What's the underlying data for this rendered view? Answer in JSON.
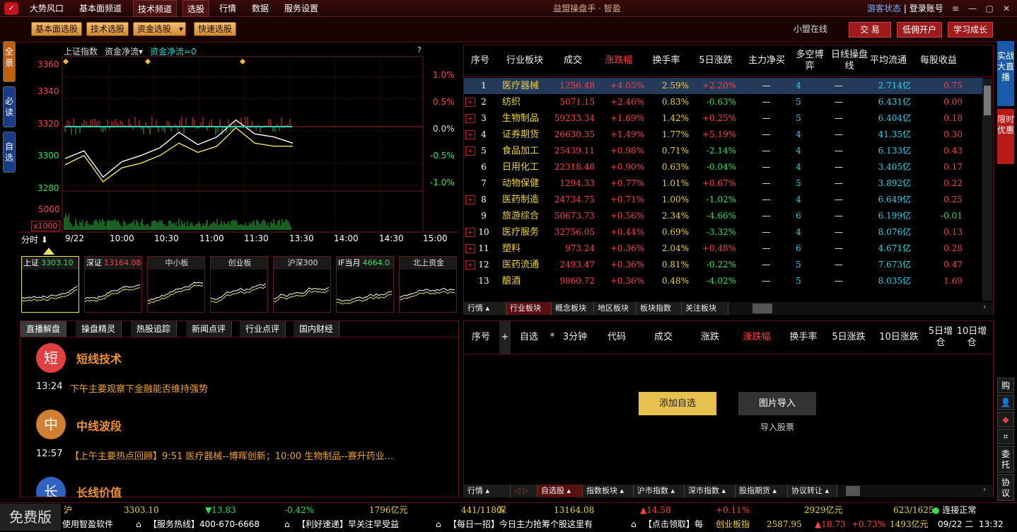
{
  "title_bar": {
    "menus": [
      "大势风口",
      "基本面频道",
      "技术频道",
      "选股",
      "行情",
      "数据",
      "服务设置"
    ],
    "app_title": "益盟操盘手 · 智盈",
    "guest": "游客状态",
    "sep": " | ",
    "login": "登录账号"
  },
  "toolbar": {
    "buttons": [
      "基本面选股",
      "技术选股",
      "资金选股",
      "快速选股"
    ],
    "online": "小盟在线",
    "trade": "交 易",
    "low_fee": "低佣开户",
    "learn": "学习成长"
  },
  "left_tabs": [
    "全景",
    "必读",
    "自选"
  ],
  "chart": {
    "index_name": "上证指数",
    "indicator": "资金净流▾",
    "indicator_value": "资金净流=0",
    "help": "?",
    "period": "分时",
    "left_ticks": [
      "3360",
      "3340",
      "3320",
      "3300",
      "3280"
    ],
    "right_ticks": [
      "1.0%",
      "0.5%",
      "0.0%",
      "-0.5%",
      "-1.0%"
    ],
    "vol_tick": "5000",
    "vol_unit": "x1000",
    "time_ticks": [
      "9/22",
      "10:00",
      "10:30",
      "11:00",
      "11:30",
      "13:30",
      "14:00",
      "14:30",
      "15:00"
    ]
  },
  "chart_data": {
    "type": "line",
    "series": [
      {
        "values": [
          3296,
          3301,
          3284,
          3294,
          3298,
          3303,
          3313,
          3305,
          3310,
          3321,
          3312,
          3310,
          3306
        ]
      },
      {
        "values": [
          3292,
          3298,
          3281,
          3290,
          3293,
          3298,
          3306,
          3300,
          3304,
          3316,
          3306,
          3304,
          3304
        ]
      }
    ],
    "ylim": [
      3275,
      3362
    ]
  },
  "thumbs": [
    {
      "name": "上证",
      "value": "3303.10",
      "color": "#30e050"
    },
    {
      "name": "深证",
      "value": "13164.08",
      "color": "#ff4040"
    },
    {
      "name": "中小板",
      "value": "",
      "color": "#fff"
    },
    {
      "name": "创业板",
      "value": "",
      "color": "#fff"
    },
    {
      "name": "沪深300",
      "value": "",
      "color": "#fff"
    },
    {
      "name": "IF当月",
      "value": "4664.0",
      "color": "#30e050"
    },
    {
      "name": "北上资金",
      "value": "",
      "color": "#fff"
    }
  ],
  "news": {
    "tabs": [
      "直播解盘",
      "操盘精灵",
      "热股追踪",
      "新闻点评",
      "行业点评",
      "国内财经"
    ],
    "items": [
      {
        "badge": "短",
        "title": "短线技术",
        "time": "13:24",
        "text": "下午主要观察下金融能否维持强势",
        "color": "#e04040"
      },
      {
        "badge": "中",
        "title": "中线波段",
        "time": "12:57",
        "text": "【上午主要热点回顾】9:51 医疗器械--博晖创新；10:00 生物制品--赛升药业...",
        "color": "#d08030"
      },
      {
        "badge": "长",
        "title": "长线价值",
        "time": "",
        "text": "",
        "color": "#3060c0"
      }
    ]
  },
  "table1": {
    "headers": [
      "序号",
      "行业板块",
      "成交",
      "涨跌幅",
      "换手率",
      "5日涨跌",
      "主力净买",
      "多空博弈",
      "日线操盘线",
      "平均流通",
      "每股收益"
    ],
    "rows": [
      [
        "1",
        "医疗器械",
        "1256.48",
        "+4.05%",
        "2.59%",
        "+2.20%",
        "—",
        "4",
        "—",
        "2.714亿",
        "0.75"
      ],
      [
        "2",
        "纺织",
        "5071.15",
        "+2.46%",
        "0.83%",
        "-0.63%",
        "—",
        "5",
        "—",
        "6.431亿",
        "0.09"
      ],
      [
        "3",
        "生物制品",
        "59233.34",
        "+1.69%",
        "1.42%",
        "+0.25%",
        "—",
        "5",
        "—",
        "6.404亿",
        "0.18"
      ],
      [
        "4",
        "证券期货",
        "26630.35",
        "+1.49%",
        "1.77%",
        "+5.19%",
        "—",
        "4",
        "—",
        "41.35亿",
        "0.30"
      ],
      [
        "5",
        "食品加工",
        "25439.11",
        "+0.98%",
        "0.71%",
        "-2.14%",
        "—",
        "4",
        "—",
        "6.133亿",
        "0.43"
      ],
      [
        "6",
        "日用化工",
        "22318.48",
        "+0.90%",
        "0.63%",
        "-0.04%",
        "—",
        "4",
        "—",
        "3.405亿",
        "0.17"
      ],
      [
        "7",
        "动物保健",
        "1294.33",
        "+0.77%",
        "1.01%",
        "+0.67%",
        "—",
        "5",
        "—",
        "3.892亿",
        "0.22"
      ],
      [
        "8",
        "医药制造",
        "24734.75",
        "+0.71%",
        "1.00%",
        "-1.02%",
        "—",
        "4",
        "—",
        "6.649亿",
        "0.25"
      ],
      [
        "9",
        "旅游综合",
        "50673.73",
        "+0.56%",
        "2.34%",
        "-4.66%",
        "—",
        "6",
        "—",
        "6.199亿",
        "-0.01"
      ],
      [
        "10",
        "医疗服务",
        "32756.05",
        "+0.44%",
        "0.69%",
        "-3.32%",
        "—",
        "4",
        "—",
        "8.076亿",
        "0.13"
      ],
      [
        "11",
        "塑料",
        "973.24",
        "+0.36%",
        "2.04%",
        "+0.48%",
        "—",
        "6",
        "—",
        "4.671亿",
        "0.28"
      ],
      [
        "12",
        "医药流通",
        "2493.47",
        "+0.36%",
        "0.81%",
        "-0.22%",
        "—",
        "5",
        "—",
        "7.673亿",
        "0.47"
      ],
      [
        "13",
        "酿酒",
        "9860.72",
        "+0.36%",
        "0.48%",
        "-4.02%",
        "—",
        "5",
        "—",
        "8.035亿",
        "1.69"
      ]
    ],
    "tabs": [
      "行情 ▴",
      "行业板块",
      "概念板块",
      "地区板块",
      "板块指数",
      "关注板块"
    ]
  },
  "table2": {
    "headers": [
      "序号",
      "+",
      "自选",
      "*",
      "3分钟",
      "代码",
      "成交",
      "涨跌",
      "涨跌幅",
      "换手率",
      "5日涨跌",
      "10日涨跌",
      "5日增仓",
      "10日增仓"
    ],
    "add_btn": "添加自选",
    "import_btn": "图片导入",
    "import_text": "导入股票",
    "tabs": [
      "行情 ▴",
      "◁ ▷",
      "自选股 ▴",
      "指数板块 ▴",
      "沪市指数 ▴",
      "深市指数 ▴",
      "股指期货 ▴",
      "协议转让 ▴"
    ]
  },
  "right_side": {
    "live": "实战大直播",
    "promo": "限时优惠",
    "icons": [
      "购",
      "委托",
      "协议"
    ]
  },
  "status": {
    "free": "免费版",
    "sh": "沪",
    "sh_val": "3303.10",
    "sh_chg": "▼13.83",
    "sh_pct": "-0.42%",
    "sh_amt": "1796亿元",
    "sh_ratio": "441/1180",
    "sz": "深",
    "sz_val": "13164.08",
    "sz_chg": "▲14.58",
    "sz_pct": "+0.11%",
    "sz_amt": "2929亿元",
    "sz_ratio": "623/1625",
    "conn": "连接正常",
    "ticker": [
      "使用智盈软件",
      "【服务热线】400-670-6668",
      "【利好速递】早关注早受益",
      "【每日一招】今日主力抢筹个股这里有",
      "【点击领取】每"
    ],
    "cy": "创业板指",
    "cy_val": "2587.95",
    "cy_chg": "▲18.73",
    "cy_pct": "+0.73%",
    "cy_amt": "1493亿元",
    "date": "09/22 二",
    "time": "13:32"
  }
}
